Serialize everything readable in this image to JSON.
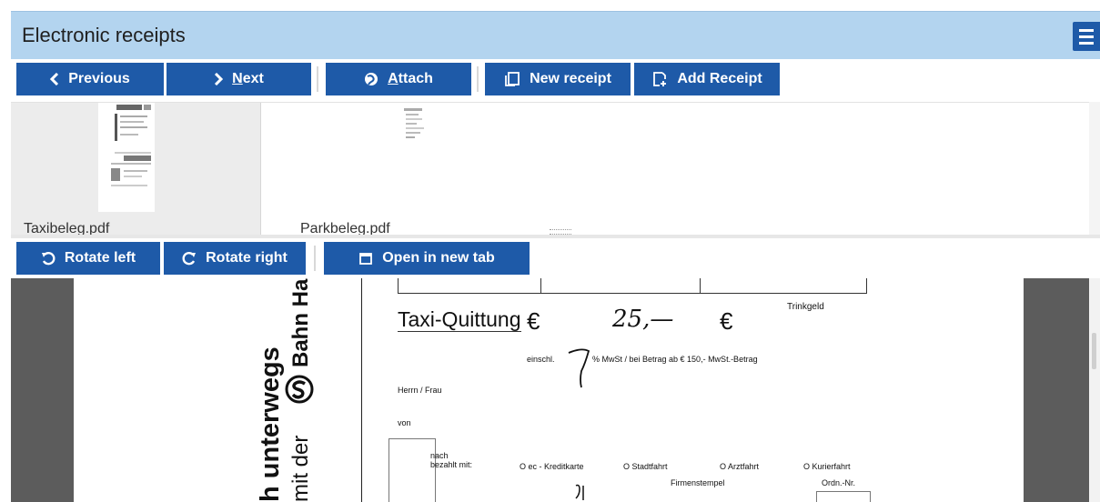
{
  "header": {
    "title": "Electronic receipts"
  },
  "toolbar_top": {
    "previous": "Previous",
    "next_prefix": "",
    "next_u": "N",
    "next_rest": "ext",
    "attach_u": "A",
    "attach_rest": "ttach",
    "new_receipt": "New receipt",
    "add_receipt": "Add Receipt"
  },
  "thumbnails": [
    {
      "caption": "Taxibeleg.pdf"
    },
    {
      "caption": "Parkbeleg.pdf"
    }
  ],
  "toolbar_bottom": {
    "rotate_left": "Rotate left",
    "rotate_right": "Rotate right",
    "open_new_tab": "Open in new tab"
  },
  "document": {
    "side_line1": "h unterwegs",
    "side_line2": "mit der",
    "side_brand": "Bahn Ha",
    "receipt_title": "Taxi-Quittung",
    "currency1": "€",
    "amount_handwritten": "25,—",
    "currency2": "€",
    "trinkgeld": "Trinkgeld",
    "tax_line_prefix": "einschl.",
    "tax_line": "% MwSt  /  bei Betrag ab € 150,-  MwSt.-Betrag",
    "herrn_frau": "Herrn / Frau",
    "von": "von",
    "nach": "nach",
    "bezahlt_mit": "bezahlt mit:",
    "opt1": "O ec - Kreditkarte",
    "opt2": "O Stadtfahrt",
    "opt3": "O Arztfahrt",
    "opt4": "O Kurierfahrt",
    "firmenstempel": "Firmenstempel",
    "ordn_nr": "Ordn.-Nr."
  },
  "colors": {
    "accent": "#1e5aa8",
    "header_bg": "#b3d4ef",
    "viewer_bg": "#5c5c5c"
  }
}
